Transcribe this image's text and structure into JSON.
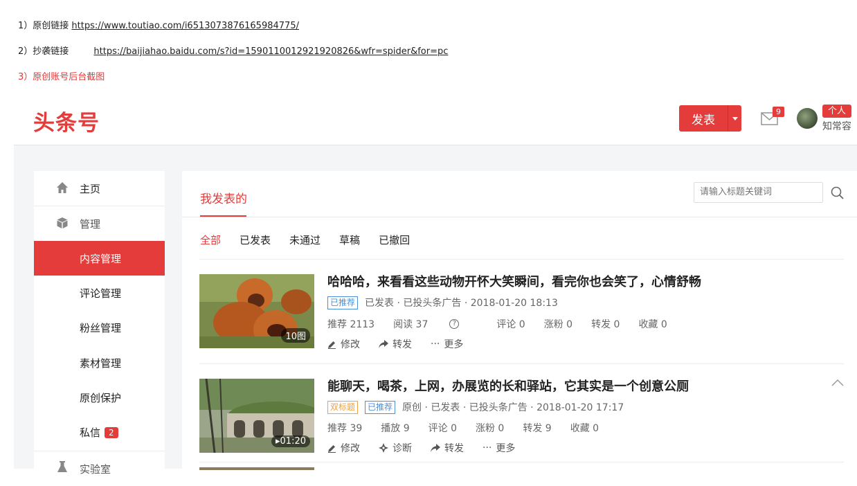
{
  "notes": {
    "line1_prefix": "1）原创链接",
    "line1_link": "https://www.toutiao.com/i6513073876165984775/",
    "line2_prefix": "2）抄袭链接",
    "line2_link": "https://baijiahao.baidu.com/s?id=1590110012921920826&wfr=spider&for=pc",
    "line3": "3）原创账号后台截图"
  },
  "header": {
    "logo": "头条号",
    "publish_label": "发表",
    "mail_count": "9",
    "account_tag": "个人",
    "username": "知常容"
  },
  "sidebar": {
    "home": "主页",
    "manage": "管理",
    "items": [
      "内容管理",
      "评论管理",
      "粉丝管理",
      "素材管理",
      "原创保护",
      "私信"
    ],
    "message_badge": "2",
    "lab": "实验室"
  },
  "main": {
    "tab": "我发表的",
    "search_placeholder": "请输入标题关键词",
    "filters": [
      "全部",
      "已发表",
      "未通过",
      "草稿",
      "已撤回"
    ]
  },
  "articles": [
    {
      "thumb_label": "10图",
      "title": "哈哈哈，来看看这些动物开怀大笑瞬间，看完你也会笑了，心情舒畅",
      "tags": [
        "已推荐"
      ],
      "meta": "已发表 · 已投头条广告 · 2018-01-20 18:13",
      "stats": [
        "推荐 2113",
        "阅读 37",
        "评论 0",
        "涨粉 0",
        "转发 0",
        "收藏 0"
      ],
      "actions": [
        "修改",
        "转发",
        "更多"
      ]
    },
    {
      "thumb_label": "01:20",
      "title": "能聊天，喝茶，上网，办展览的长和驿站，它其实是一个创意公厕",
      "tags": [
        "双标题",
        "已推荐"
      ],
      "meta": "原创 · 已发表 · 已投头条广告 · 2018-01-20 17:17",
      "stats": [
        "推荐 39",
        "播放 9",
        "评论 0",
        "涨粉 0",
        "转发 9",
        "收藏 0"
      ],
      "actions": [
        "修改",
        "诊断",
        "转发",
        "更多"
      ]
    }
  ],
  "colors": {
    "brand": "#e43b3b",
    "tag_blue": "#4a90d9",
    "tag_orange": "#f0a040"
  }
}
